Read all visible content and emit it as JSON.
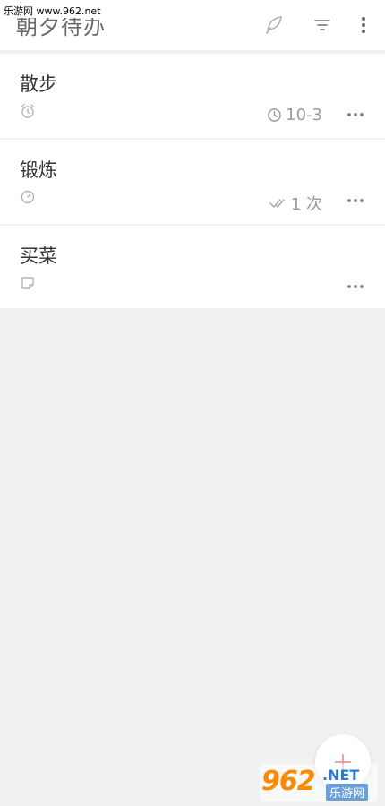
{
  "watermark": {
    "top_text": "乐游网 www.962.net",
    "logo_number": "962",
    "logo_suffix": ".NET",
    "logo_cn": "乐游网"
  },
  "header": {
    "title": "朝夕待办",
    "icons": [
      "feather-icon",
      "filter-icon",
      "more-vertical-icon"
    ]
  },
  "tasks": [
    {
      "title": "散步",
      "type_icon": "alarm-clock-icon",
      "meta_icon": "clock-icon",
      "meta_text": "10-3"
    },
    {
      "title": "锻炼",
      "type_icon": "timer-icon",
      "meta_icon": "double-check-icon",
      "meta_text": "1 次"
    },
    {
      "title": "买菜",
      "type_icon": "note-icon",
      "meta_icon": "",
      "meta_text": ""
    }
  ],
  "fab": {
    "icon": "plus-icon"
  },
  "colors": {
    "background": "#f0f1f3",
    "card": "#ffffff",
    "title_text": "#333333",
    "meta_text": "#9a9a9a",
    "fab_plus": "#e8a0a8"
  }
}
